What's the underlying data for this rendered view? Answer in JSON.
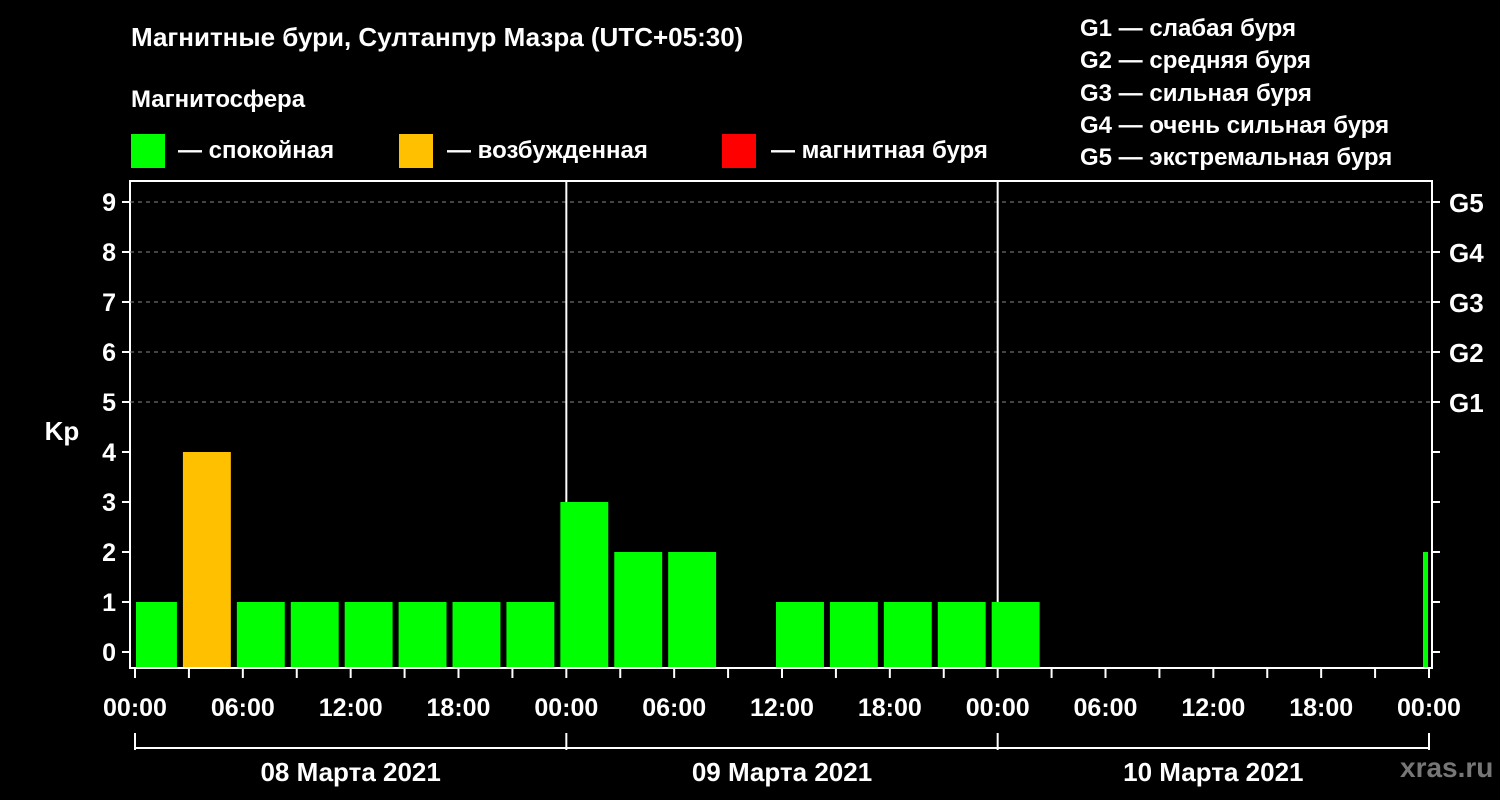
{
  "chart_data": {
    "type": "bar",
    "title": "Магнитные бури, Султанпур Мазра (UTC+05:30)",
    "subtitle": "Магнитосфера",
    "ylabel": "Kp",
    "ylim": [
      0,
      9
    ],
    "yticks": [
      "0",
      "1",
      "2",
      "3",
      "4",
      "5",
      "6",
      "7",
      "8",
      "9"
    ],
    "g_scale": [
      {
        "kp": 5,
        "label": "G1"
      },
      {
        "kp": 6,
        "label": "G2"
      },
      {
        "kp": 7,
        "label": "G3"
      },
      {
        "kp": 8,
        "label": "G4"
      },
      {
        "kp": 9,
        "label": "G5"
      }
    ],
    "xlim_hours": [
      0,
      72
    ],
    "xtick_labels": [
      "00:00",
      "06:00",
      "12:00",
      "18:00",
      "00:00",
      "06:00",
      "12:00",
      "18:00",
      "00:00",
      "06:00",
      "12:00",
      "18:00",
      "00:00"
    ],
    "days": [
      "08 Марта 2021",
      "09 Марта 2021",
      "10 Марта 2021"
    ],
    "bars": [
      {
        "start": "08 Марта 2021 00:00",
        "end": "08 Марта 2021 02:30",
        "kp": 1,
        "state": "calm"
      },
      {
        "start": "08 Марта 2021 02:30",
        "end": "08 Марта 2021 05:30",
        "kp": 4,
        "state": "excited"
      },
      {
        "start": "08 Марта 2021 05:30",
        "end": "08 Марта 2021 08:30",
        "kp": 1,
        "state": "calm"
      },
      {
        "start": "08 Марта 2021 08:30",
        "end": "08 Марта 2021 11:30",
        "kp": 1,
        "state": "calm"
      },
      {
        "start": "08 Марта 2021 11:30",
        "end": "08 Марта 2021 14:30",
        "kp": 1,
        "state": "calm"
      },
      {
        "start": "08 Марта 2021 14:30",
        "end": "08 Марта 2021 17:30",
        "kp": 1,
        "state": "calm"
      },
      {
        "start": "08 Марта 2021 17:30",
        "end": "08 Марта 2021 20:30",
        "kp": 1,
        "state": "calm"
      },
      {
        "start": "08 Марта 2021 20:30",
        "end": "08 Марта 2021 23:30",
        "kp": 1,
        "state": "calm"
      },
      {
        "start": "08 Марта 2021 23:30",
        "end": "09 Марта 2021 02:30",
        "kp": 3,
        "state": "calm"
      },
      {
        "start": "09 Марта 2021 02:30",
        "end": "09 Марта 2021 05:30",
        "kp": 2,
        "state": "calm"
      },
      {
        "start": "09 Марта 2021 05:30",
        "end": "09 Марта 2021 08:30",
        "kp": 2,
        "state": "calm"
      },
      {
        "start": "09 Марта 2021 11:30",
        "end": "09 Марта 2021 14:30",
        "kp": 1,
        "state": "calm"
      },
      {
        "start": "09 Марта 2021 14:30",
        "end": "09 Марта 2021 17:30",
        "kp": 1,
        "state": "calm"
      },
      {
        "start": "09 Марта 2021 17:30",
        "end": "09 Марта 2021 20:30",
        "kp": 1,
        "state": "calm"
      },
      {
        "start": "09 Марта 2021 20:30",
        "end": "09 Марта 2021 23:30",
        "kp": 1,
        "state": "calm"
      },
      {
        "start": "09 Марта 2021 23:30",
        "end": "10 Марта 2021 02:30",
        "kp": 1,
        "state": "calm"
      },
      {
        "start": "10 Марта 2021 23:30",
        "end": "11 Марта 2021 00:00",
        "kp": 2,
        "state": "calm"
      }
    ],
    "legend": [
      {
        "state": "calm",
        "label": "— спокойная",
        "color": "#00ff00"
      },
      {
        "state": "excited",
        "label": "— возбужденная",
        "color": "#ffc000"
      },
      {
        "state": "storm",
        "label": "— магнитная буря",
        "color": "#ff0000"
      }
    ],
    "g_legend": [
      "G1 — слабая буря",
      "G2 — средняя буря",
      "G3 — сильная буря",
      "G4 — очень сильная буря",
      "G5 — экстремальная буря"
    ],
    "grid": true,
    "legend_position": "top"
  },
  "watermark": "xras.ru"
}
